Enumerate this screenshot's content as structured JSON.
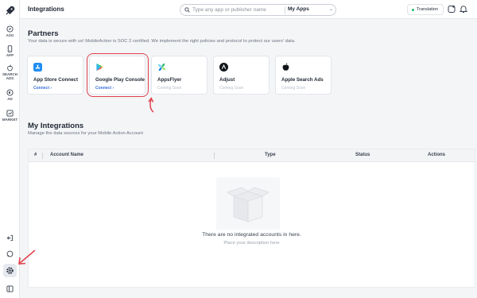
{
  "header": {
    "title": "Integrations",
    "search_placeholder": "Type any app or publisher name",
    "app_selector": "My Apps",
    "translation": "Translation"
  },
  "sidebar": {
    "items": [
      {
        "label": "ASO",
        "icon": "compass-icon"
      },
      {
        "label": "APP",
        "icon": "phone-icon"
      },
      {
        "label": "SEARCH ADS",
        "icon": "apple-icon"
      },
      {
        "label": "AD",
        "icon": "megaphone-icon"
      },
      {
        "label": "MARKET",
        "icon": "chart-icon"
      }
    ],
    "bottom": [
      "logout-icon",
      "support-icon",
      "gear-icon",
      "collapse-icon"
    ]
  },
  "partners": {
    "title": "Partners",
    "subtitle": "Your data is secure with us! MobileAction is SOC 2 certified. We implement the right policies and protocol to protect our users' data.",
    "cards": [
      {
        "name": "App Store Connect",
        "action": "Connect  ›",
        "status": "connect",
        "icon": "app-store-icon"
      },
      {
        "name": "Google Play Console",
        "action": "Connect  ›",
        "status": "connect",
        "icon": "google-play-icon"
      },
      {
        "name": "AppsFlyer",
        "action": "Coming Soon",
        "status": "soon",
        "icon": "appsflyer-icon"
      },
      {
        "name": "Adjust",
        "action": "Coming Soon",
        "status": "soon",
        "icon": "adjust-icon"
      },
      {
        "name": "Apple Search Ads",
        "action": "Coming Soon",
        "status": "soon",
        "icon": "apple-icon"
      }
    ]
  },
  "integrations": {
    "title": "My Integrations",
    "subtitle": "Manage the data sources for your Mobile Action Account",
    "columns": [
      "#",
      "Account Name",
      "Type",
      "Status",
      "Actions"
    ],
    "empty_title": "There are no integrated accounts in here.",
    "empty_subtitle": "Place your description here"
  },
  "colors": {
    "accent": "#3a6fd8",
    "highlight": "#e0424d",
    "status_online": "#1fb86a"
  }
}
